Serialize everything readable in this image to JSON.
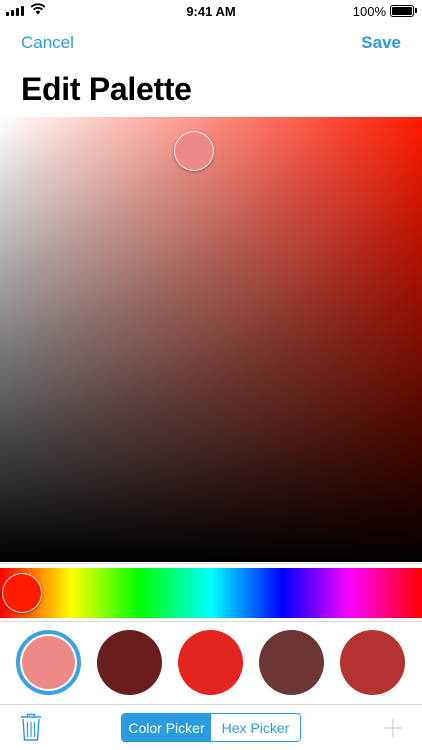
{
  "status_bar": {
    "time": "9:41 AM",
    "battery": "100%"
  },
  "nav": {
    "cancel_label": "Cancel",
    "save_label": "Save"
  },
  "title": "Edit Palette",
  "picker": {
    "hue_color": "#ff1a00",
    "selected_color": "#ec8a87"
  },
  "swatches": [
    {
      "color": "#ec8a87",
      "selected": true
    },
    {
      "color": "#6b1e1e",
      "selected": false
    },
    {
      "color": "#e52420",
      "selected": false
    },
    {
      "color": "#6e3536",
      "selected": false
    },
    {
      "color": "#b4332e",
      "selected": false
    }
  ],
  "toolbar": {
    "segments": [
      "Color Picker",
      "Hex Picker"
    ],
    "active_segment": 0,
    "accent_color": "#2a9cde",
    "icons": [
      "trash-icon",
      "plus-icon"
    ]
  }
}
